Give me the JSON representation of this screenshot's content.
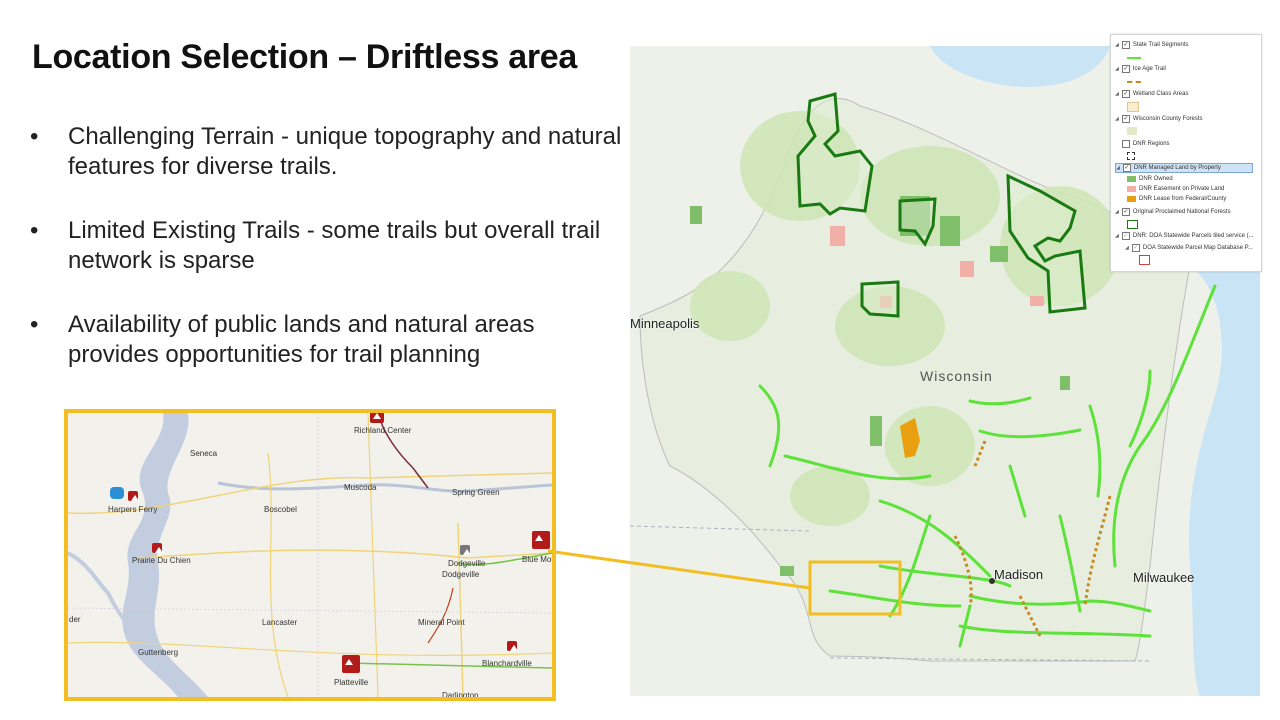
{
  "slide": {
    "title": "Location Selection – Driftless area",
    "bullet_glyph": "•",
    "bullets": [
      "Challenging Terrain - unique topography and natural features for diverse trails.",
      "Limited Existing Trails - some trails but overall trail network is sparse",
      "Availability of public lands and natural areas provides opportunities for trail planning"
    ]
  },
  "inset_map": {
    "labels": {
      "richland_center": "Richland Center",
      "seneca": "Seneca",
      "muscoda": "Muscoda",
      "spring_green": "Spring Green",
      "harpers_ferry": "Harpers Ferry",
      "boscobel": "Boscobel",
      "prairie_du_chien": "Prairie Du Chien",
      "dodgeville_a": "Dodgeville",
      "dodgeville_b": "Dodgeville",
      "blue_mounds": "Blue Mou",
      "der": "der",
      "lancaster": "Lancaster",
      "mineral_point": "Mineral Point",
      "guttenberg": "Guttenberg",
      "blanchardville": "Blanchardville",
      "platteville": "Platteville",
      "darlington": "Darlington"
    },
    "colors": {
      "border": "#f2be22",
      "pin": "#b31b1b",
      "river": "#b9c4d8",
      "road": "#f3d98a"
    }
  },
  "main_map": {
    "labels": {
      "minneapolis": "Minneapolis",
      "wisconsin": "Wisconsin",
      "madison": "Madison",
      "milwaukee": "Milwaukee"
    },
    "colors": {
      "trail": "#5de23a",
      "forest_outline": "#1a7a12",
      "lake": "#c8e4f5",
      "dnr_owned": "#7fbf6a",
      "easement": "#f0b0a8",
      "lease": "#e8a010"
    }
  },
  "legend": {
    "items": [
      {
        "label": "State Trail Segments",
        "checked": true
      },
      {
        "label": "Ice Age Trail",
        "checked": true
      },
      {
        "label": "Wetland Class Areas",
        "checked": true
      },
      {
        "label": "Wisconsin County Forests",
        "checked": true
      },
      {
        "label": "DNR Regions",
        "checked": false
      },
      {
        "label": "DNR Managed Land by Property",
        "checked": true
      },
      {
        "label": "DNR Owned",
        "checked": null
      },
      {
        "label": "DNR Easement on Private Land",
        "checked": null
      },
      {
        "label": "DNR Lease from Federal/County",
        "checked": null
      },
      {
        "label": "Original Proclaimed National Forests",
        "checked": true
      },
      {
        "label": "DNR: DOA Statewide Parcels tiled service (...",
        "checked": true
      },
      {
        "label": "DOA Statewide Parcel Map Database P...",
        "checked": true
      }
    ],
    "checkmark": "✓"
  }
}
